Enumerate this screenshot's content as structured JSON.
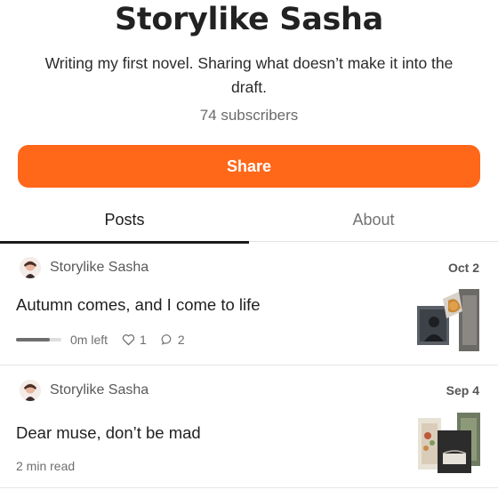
{
  "publication": {
    "title": "Storylike Sasha",
    "description": "Writing my first novel. Sharing what doesn’t make it into the draft.",
    "subscribers": "74 subscribers"
  },
  "share_button": {
    "label": "Share"
  },
  "colors": {
    "accent": "#ff6719",
    "text": "#1f1f1f",
    "muted": "#6e6e6e"
  },
  "tabs": [
    {
      "label": "Posts",
      "active": true
    },
    {
      "label": "About",
      "active": false
    }
  ],
  "posts": [
    {
      "author": "Storylike Sasha",
      "date": "Oct 2",
      "title": "Autumn comes, and I come to life",
      "read_status": "0m left",
      "read_progress": 0.75,
      "likes": "1",
      "comments": "2",
      "like_icon": "heart-icon",
      "comment_icon": "comment-icon"
    },
    {
      "author": "Storylike Sasha",
      "date": "Sep 4",
      "title": "Dear muse, don’t be mad",
      "read_status": "2 min read"
    }
  ]
}
